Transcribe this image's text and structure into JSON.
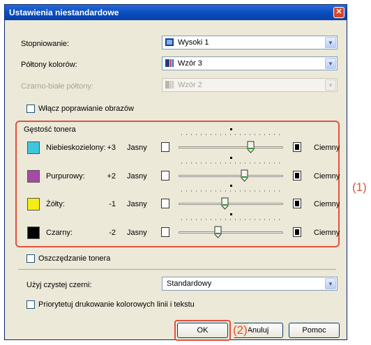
{
  "dialog": {
    "title": "Ustawienia niestandardowe",
    "gradation_label": "Stopniowanie:",
    "gradation_value": "Wysoki 1",
    "halftones_label": "Półtony kolorów:",
    "halftones_value": "Wzór 3",
    "bw_halftones_label": "Czarno-białe półtony:",
    "bw_halftones_value": "Wzór 2",
    "image_refinement_label": "Włącz poprawianie obrazów",
    "toner_density_label": "Gęstość tonera",
    "toner_save_label": "Oszczędzanie tonera",
    "pure_black_label": "Użyj czystej czerni:",
    "pure_black_value": "Standardowy",
    "prioritize_label": "Priorytetuj drukowanie kolorowych linii i tekstu",
    "ok_label": "OK",
    "cancel_label": "Anuluj",
    "help_label": "Pomoc"
  },
  "toner": [
    {
      "name": "Niebieskozielony:",
      "value": "+3",
      "color": "#3fc6dc",
      "level": 3
    },
    {
      "name": "Purpurowy:",
      "value": "+2",
      "color": "#a64aa6",
      "level": 2
    },
    {
      "name": "Żółty:",
      "value": "-1",
      "color": "#f5ee14",
      "level": -1
    },
    {
      "name": "Czarny:",
      "value": "-2",
      "color": "#000000",
      "level": -2
    }
  ],
  "scale": {
    "light": "Jasny",
    "dark": "Ciemny"
  },
  "callouts": {
    "one": "(1)",
    "two": "(2)"
  }
}
